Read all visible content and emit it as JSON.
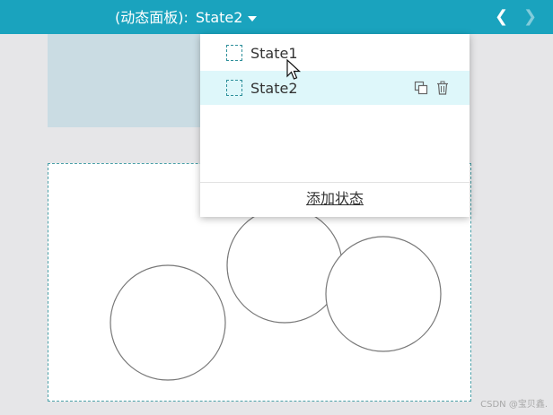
{
  "toolbar": {
    "prefix": "(动态面板):",
    "current_state": "State2",
    "prev_icon": "chevron-left-icon",
    "next_icon": "chevron-right-icon",
    "background_color": "#1aa3be"
  },
  "dropdown": {
    "states": [
      {
        "label": "State1",
        "icon": "dashed-square-icon"
      },
      {
        "label": "State2",
        "icon": "dashed-square-icon",
        "selected": true,
        "actions": [
          "copy-icon",
          "delete-icon"
        ]
      }
    ],
    "add_state_label": "添加状态"
  },
  "watermark": "CSDN @宝贝鑫."
}
